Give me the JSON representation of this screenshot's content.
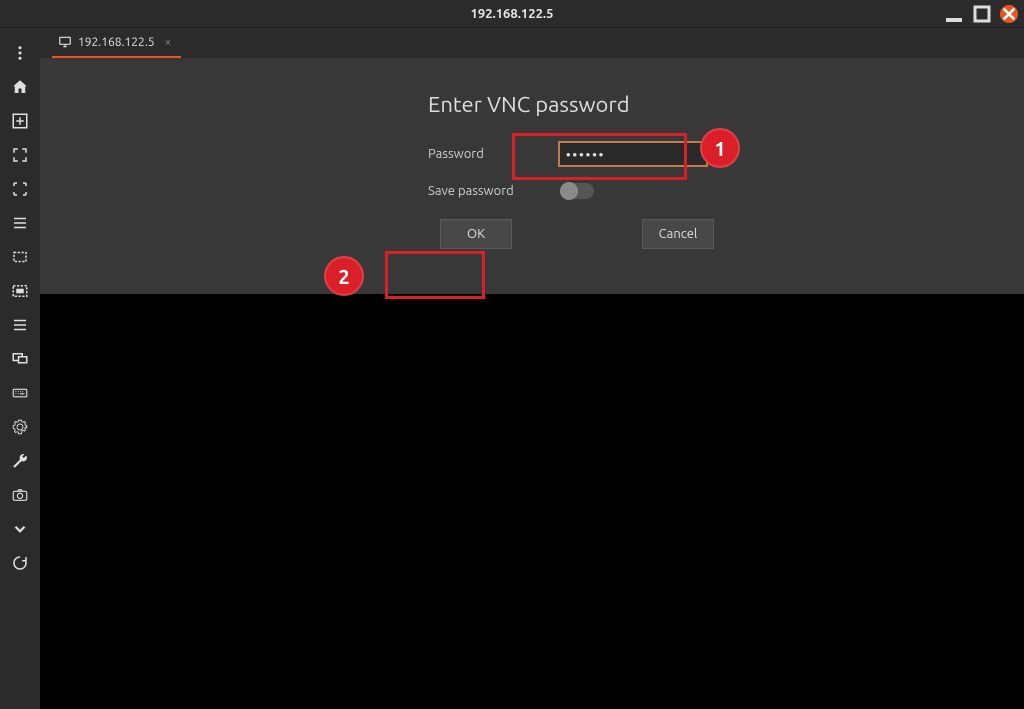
{
  "window": {
    "title": "192.168.122.5"
  },
  "tab": {
    "label": "192.168.122.5"
  },
  "dialog": {
    "title": "Enter VNC password",
    "password_label": "Password",
    "password_value": "••••••",
    "save_label": "Save password",
    "save_toggle": false,
    "ok_label": "OK",
    "cancel_label": "Cancel"
  },
  "annotations": {
    "callout1": "1",
    "callout2": "2"
  },
  "sidebar_icons": [
    "more-vert-icon",
    "home-icon",
    "add-tab-icon",
    "fullscreen-enter-icon",
    "fullscreen-corners-icon",
    "list-icon",
    "scale-fit-icon",
    "scale-fill-icon",
    "list2-icon",
    "multi-monitor-icon",
    "keyboard-icon",
    "gear-icon",
    "wrench-icon",
    "camera-icon",
    "chevron-down-icon",
    "refresh-icon"
  ]
}
